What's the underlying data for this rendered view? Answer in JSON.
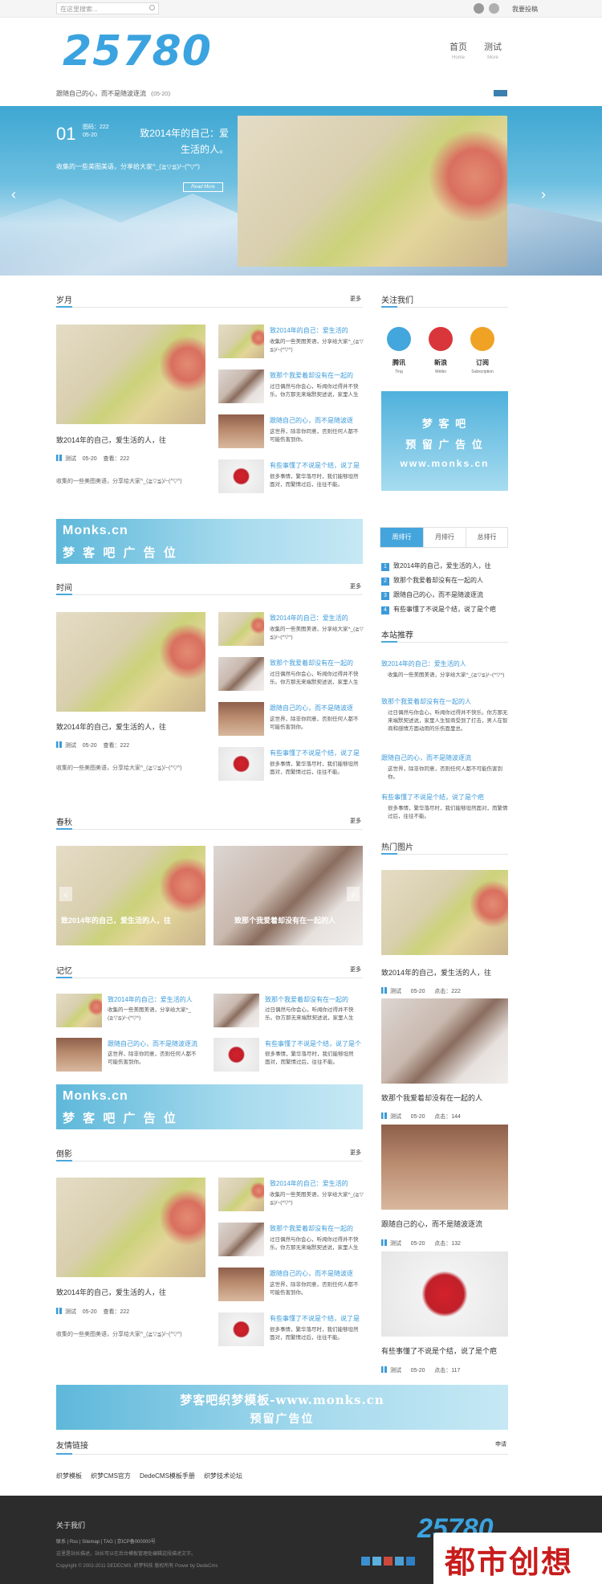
{
  "topbar": {
    "search_placeholder": "在这里搜索...",
    "contribute": "我要投稿"
  },
  "header": {
    "logo": "25780",
    "tagline": "跟随自己的心，而不是随波逐流",
    "tagline_date": "《05-20》",
    "nav": [
      {
        "label": "首页",
        "en": "Home"
      },
      {
        "label": "测试",
        "en": "More"
      }
    ]
  },
  "banner": {
    "number": "01",
    "meta1": "图码：222",
    "meta2": "05-20",
    "title": "致2014年的自己：爱生活的人。",
    "desc": "收集的一些美图美语，分享给大家^_(≧▽≦)/~(^▽^)",
    "more": "Read More"
  },
  "sections": {
    "s1": {
      "title": "岁月",
      "more": "更多"
    },
    "s2": {
      "title": "时间",
      "more": "更多"
    },
    "s3": {
      "title": "春秋",
      "more": "更多"
    },
    "s4": {
      "title": "记忆",
      "more": "更多"
    },
    "s5": {
      "title": "倒影",
      "more": "更多"
    }
  },
  "post_main": {
    "title": "致2014年的自己，爱生活的人，往",
    "author": "测试",
    "date": "05-20",
    "views": "查看：222",
    "desc": "收集的一些美图美语，分享给大家^_(≧▽≦)/~(^▽^)"
  },
  "side_posts": [
    {
      "title": "致2014年的自己：爱生活的",
      "desc1": "收集的一些美图美语，分享给大家^_(≧▽",
      "desc2": "≦)/~(^▽^)"
    },
    {
      "title": "致那个我爱着却没有在一起的",
      "desc1": "过日偶然与你会心，听闻你过得并不快",
      "desc2": "乐。你方那无来端默契述说，家里人生"
    },
    {
      "title": "跟随自己的心，而不是随波逐",
      "desc1": "这世界，除非你同意，否则任何人都不",
      "desc2": "可能伤害到你。"
    },
    {
      "title": "有些事懂了不说是个结，说了是",
      "desc1": "很多事情，繁华落尽时，我们能够坦然",
      "desc2": "面对，而繁情过后，往往不能。"
    }
  ],
  "slider": {
    "cap1": "致2014年的自己，爱生活的人，往",
    "cap2": "致那个我爱着却没有在一起的人"
  },
  "memory": [
    {
      "title": "致2014年的自己：爱生活的人",
      "desc1": "收集的一些美图美语，分享给大家^_",
      "desc2": "(≧▽≦)/~(^▽^)"
    },
    {
      "title": "致那个我爱着却没有在一起的",
      "desc1": "过日偶然与你会心，听闻你过得并不快",
      "desc2": "乐。你方那无来端默契述说，家里人生"
    },
    {
      "title": "跟随自己的心，而不是随波逐流",
      "desc1": "这世界，除非你同意，否则任何人都不",
      "desc2": "可能伤害到你。"
    },
    {
      "title": "有些事懂了不说是个结，说了是个",
      "desc1": "很多事情，繁华落尽时，我们能够坦然",
      "desc2": "面对，而繁情过后，往往不能。"
    }
  ],
  "ads": {
    "ad1_top": "Monks.cn",
    "ad1_bottom": "梦 客 吧 广 告 位",
    "bottom1": "梦客吧织梦模板-www.monks.cn",
    "bottom2": "预留广告位"
  },
  "sidebar": {
    "follow": "关注我们",
    "icons": [
      {
        "name": "腾讯",
        "en": "Ting"
      },
      {
        "name": "新浪",
        "en": "Weibo"
      },
      {
        "name": "订阅",
        "en": "Subscription"
      }
    ],
    "ad_lines": [
      "梦 客 吧",
      "预 留 广 告 位",
      "www.monks.cn"
    ],
    "tabs": [
      "周排行",
      "月排行",
      "总排行"
    ],
    "rank": [
      "致2014年的自己，爱生活的人，往",
      "致那个我爱着却没有在一起的人",
      "跟随自己的心，而不是随波逐流",
      "有些事懂了不说是个结，说了是个疤"
    ],
    "recommend": "本站推荐",
    "rec": [
      {
        "title": "致2014年的自己：爱生活的人",
        "desc": "收集的一些美图美语，分享给大家^_(≧▽≦)/~(^▽^)"
      },
      {
        "title": "致那个我爱着却没有在一起的人",
        "desc": "过日偶然与你会心，听闻你过得并不快乐。你方那无来端默契述说，家里人生智商受到了打击，男人在智商和感情方面动用的乐伤面里总。"
      },
      {
        "title": "跟随自己的心，而不是随波逐流",
        "desc": "这世界，除非你同意，否则任何人都不可能伤害到你。"
      },
      {
        "title": "有些事懂了不说是个结，说了是个疤",
        "desc": "很多事情，繁华落尽时，我们能够坦然面对，而繁情过后，往往不能。"
      }
    ],
    "hot": "热门图片",
    "hot_items": [
      {
        "title": "致2014年的自己，爱生活的人，往",
        "date": "05-20",
        "clicks": "点击：222"
      },
      {
        "title": "致那个我爱着却没有在一起的人",
        "date": "05-20",
        "clicks": "点击：144"
      },
      {
        "title": "跟随自己的心，而不是随波逐流",
        "date": "05-20",
        "clicks": "点击：132"
      },
      {
        "title": "有些事懂了不说是个结，说了是个疤",
        "date": "05-20",
        "clicks": "点击：117"
      }
    ],
    "author": "测试"
  },
  "links": {
    "title": "友情链接",
    "apply": "申请",
    "items": [
      "织梦模板",
      "织梦CMS官方",
      "DedeCMS模板手册",
      "织梦技术论坛"
    ]
  },
  "footer": {
    "about": "关于我们",
    "links": "联系 | Rss | Sitemap | TAG | 京ICP备000000号",
    "line2": "这里是站长描述，站长可以在后台模板管理处编辑这段描述文字。",
    "copyright": "Copyright © 2002-2011 DEDECMS. 织梦科技 版权所有 Power by DedeCms",
    "logo": "25780"
  },
  "watermark": "都市创想"
}
